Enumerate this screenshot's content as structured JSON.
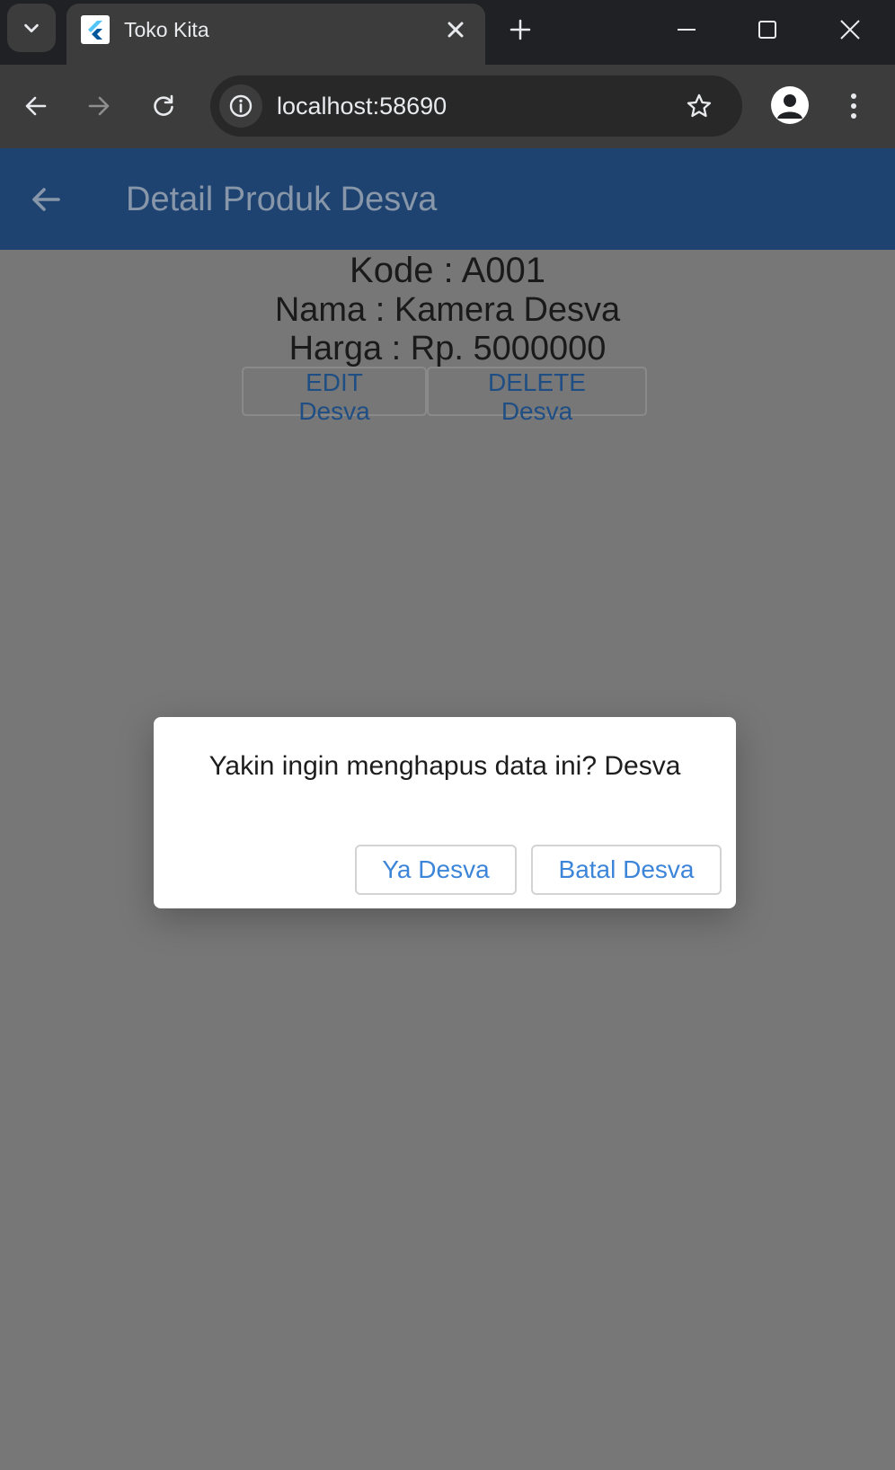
{
  "browser": {
    "tab_title": "Toko Kita",
    "url": "localhost:58690",
    "icons": {
      "tab_search": "chevron-down-icon",
      "favicon": "flutter-icon",
      "tab_close": "close-icon",
      "new_tab": "plus-icon",
      "minimize": "minimize-icon",
      "maximize": "maximize-icon",
      "close_window": "close-icon",
      "back": "arrow-left-icon",
      "forward": "arrow-right-icon",
      "reload": "reload-icon",
      "site_info": "info-icon",
      "bookmark": "star-icon",
      "profile": "avatar-icon",
      "menu": "kebab-menu-icon"
    }
  },
  "app": {
    "title": "Detail Produk Desva",
    "product": {
      "kode": "Kode : A001",
      "nama": "Nama : Kamera Desva",
      "harga": "Harga : Rp. 5000000"
    },
    "edit_label": "EDIT Desva",
    "delete_label": "DELETE Desva"
  },
  "dialog": {
    "message": "Yakin ingin menghapus data ini? Desva",
    "confirm_label": "Ya Desva",
    "cancel_label": "Batal Desva"
  },
  "colors": {
    "appbar": "#1f4370",
    "dialog_button_text": "#3d85d8",
    "scrim": "#777777"
  }
}
